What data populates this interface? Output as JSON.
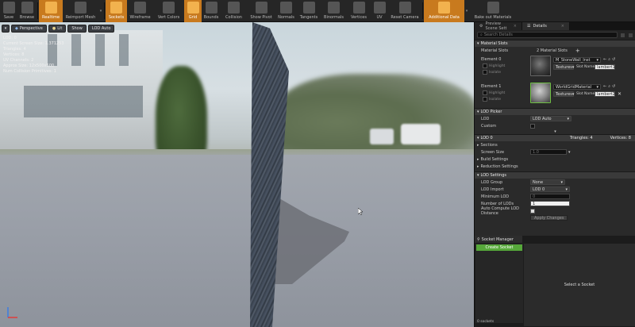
{
  "toolbar": {
    "buttons": [
      {
        "label": "Save",
        "icon": "save-icon",
        "active": false
      },
      {
        "label": "Browse",
        "icon": "browse-icon",
        "active": false
      },
      {
        "label": "Realtime",
        "icon": "realtime-icon",
        "active": true
      },
      {
        "label": "Reimport Mesh",
        "icon": "reimport-icon",
        "active": false
      },
      {
        "label": "Sockets",
        "icon": "sockets-icon",
        "active": true
      },
      {
        "label": "Wireframe",
        "icon": "wireframe-icon",
        "active": false
      },
      {
        "label": "Vert Colors",
        "icon": "vert-colors-icon",
        "active": false
      },
      {
        "label": "Grid",
        "icon": "grid-icon",
        "active": true
      },
      {
        "label": "Bounds",
        "icon": "bounds-icon",
        "active": false
      },
      {
        "label": "Collision",
        "icon": "collision-icon",
        "active": false
      },
      {
        "label": "Show Pivot",
        "icon": "pivot-icon",
        "active": false
      },
      {
        "label": "Normals",
        "icon": "normals-icon",
        "active": false
      },
      {
        "label": "Tangents",
        "icon": "tangents-icon",
        "active": false
      },
      {
        "label": "Binormals",
        "icon": "binormals-icon",
        "active": false
      },
      {
        "label": "Vertices",
        "icon": "vertices-icon",
        "active": false
      },
      {
        "label": "UV",
        "icon": "uv-icon",
        "active": false
      },
      {
        "label": "Reset Camera",
        "icon": "camera-icon",
        "active": false
      },
      {
        "label": "Additional Data",
        "icon": "additional-data-icon",
        "active": true
      },
      {
        "label": "Bake out Materials",
        "icon": "bake-icon",
        "active": false
      }
    ]
  },
  "viewport": {
    "perspective": "Perspective",
    "lit": "Lit",
    "show": "Show",
    "lod": "LOD Auto",
    "stats": [
      "LOD: 0",
      "Current Screen Size: 1.371253",
      "Triangles: 4",
      "Vertices: 8",
      "UV Channels: 2",
      "Approx Size: 12x500x500",
      "Num Collision Primitives: 1"
    ]
  },
  "tabs": {
    "preview": "Preview Scene Sett",
    "details": "Details"
  },
  "search": {
    "placeholder": "Search Details"
  },
  "material_slots": {
    "header": "Material Slots",
    "label": "Material Slots",
    "count": "2 Material Slots",
    "elements": [
      {
        "name": "Element 0",
        "material": "M_StoneWall_Inst",
        "tex": "Textures",
        "slot_label": "Slot Name",
        "slot_value": "lambert1",
        "highlight": "Highlight",
        "isolate": "Isolate"
      },
      {
        "name": "Element 1",
        "material": "WorldGridMaterial",
        "tex": "Textures",
        "slot_label": "Slot Name",
        "slot_value": "lambert2",
        "highlight": "Highlight",
        "isolate": "Isolate"
      }
    ]
  },
  "lod_picker": {
    "header": "LOD Picker",
    "lod_label": "LOD",
    "lod_value": "LOD Auto",
    "custom_label": "Custom"
  },
  "lod0": {
    "header": "LOD 0",
    "triangles": "Triangles: 4",
    "vertices": "Vertices: 8",
    "sections": "Sections",
    "screen_size_label": "Screen Size",
    "screen_size_value": "1.0",
    "build_settings": "Build Settings",
    "reduction_settings": "Reduction Settings"
  },
  "lod_settings": {
    "header": "LOD Settings",
    "group_label": "LOD Group",
    "group_value": "None",
    "import_label": "LOD Import",
    "import_value": "LOD 0",
    "min_label": "Minimum LOD",
    "min_value": "0",
    "num_label": "Number of LODs",
    "num_value": "1",
    "auto_label": "Auto Compute LOD Distance",
    "apply": "Apply Changes"
  },
  "socket_manager": {
    "tab": "Socket Manager",
    "create": "Create Socket",
    "count": "0 sockets",
    "empty": "Select a Socket"
  },
  "colors": {
    "accent_orange": "#c87a1e",
    "create_green": "#56a83a"
  }
}
